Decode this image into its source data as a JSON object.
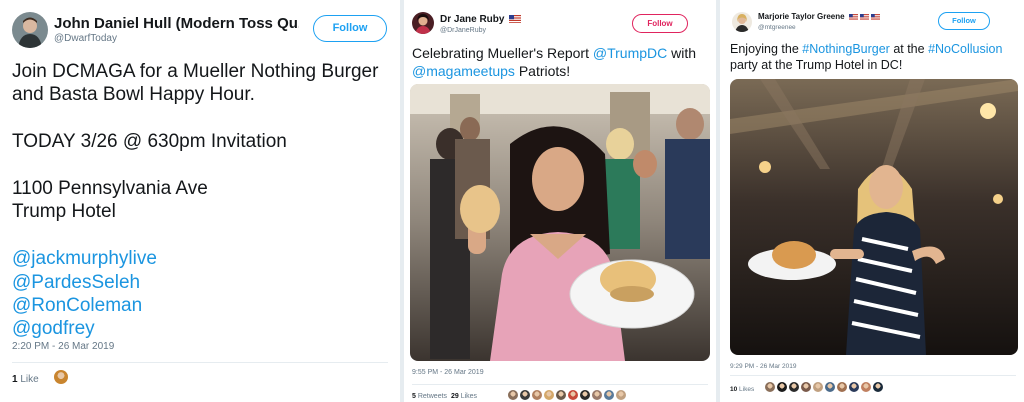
{
  "tweet1": {
    "name": "John Daniel Hull (Modern Toss Qu...",
    "handle": "@DwarfToday",
    "follow_label": "Follow",
    "lines": [
      {
        "text": "Join DCMAGA for a Mueller Nothing Burger",
        "link": false
      },
      {
        "text": "and Basta Bowl Happy Hour.",
        "link": false
      },
      {
        "text": "",
        "link": false
      },
      {
        "text": "TODAY 3/26 @ 630pm Invitation",
        "link": false
      },
      {
        "text": "",
        "link": false
      },
      {
        "text": "1100 Pennsylvania Ave",
        "link": false
      },
      {
        "text": "Trump Hotel",
        "link": false
      },
      {
        "text": "",
        "link": false
      },
      {
        "text": "@jackmurphylive",
        "link": true
      },
      {
        "text": "@PardesSeleh",
        "link": true
      },
      {
        "text": "@RonColeman",
        "link": true
      },
      {
        "text": "@godfrey",
        "link": true
      }
    ],
    "timestamp": "2:20 PM - 26 Mar 2019",
    "likes_count": "1",
    "likes_label": "Like",
    "liker_colors": [
      "#c9852f"
    ]
  },
  "tweet2": {
    "name": "Dr Jane Ruby",
    "flag": "us-flag-icon",
    "handle": "@DrJaneRuby",
    "follow_label": "Follow",
    "follow_color": "#e0245e",
    "segments": [
      {
        "text": "Celebrating Mueller's Report ",
        "link": false
      },
      {
        "text": "@TrumpDC",
        "link": true
      },
      {
        "text": " with ",
        "link": false
      },
      {
        "text": "@magameetups",
        "link": true
      },
      {
        "text": " Patriots!",
        "link": false
      }
    ],
    "timestamp": "9:55 PM - 26 Mar 2019",
    "retweets_count": "5",
    "retweets_label": "Retweets",
    "likes_count": "29",
    "likes_label": "Likes",
    "liker_colors": [
      "#8a6f5a",
      "#3b3b3b",
      "#b08060",
      "#d4a86a",
      "#6a5a4a",
      "#c74a3a",
      "#2a2a2a",
      "#9a7a6a",
      "#5a7a9a",
      "#c0a080"
    ]
  },
  "tweet3": {
    "name": "Marjorie Taylor Greene",
    "flags": [
      "us-flag-icon",
      "us-flag-icon",
      "us-flag-icon"
    ],
    "handle": "@mtgreenee",
    "follow_label": "Follow",
    "segments": [
      {
        "text": "Enjoying the ",
        "link": false
      },
      {
        "text": "#NothingBurger",
        "link": true
      },
      {
        "text": " at the ",
        "link": false
      },
      {
        "text": "#NoCollusion",
        "link": true
      },
      {
        "text": " party at the Trump Hotel in DC!",
        "link": false
      }
    ],
    "timestamp": "9:29 PM - 26 Mar 2019",
    "likes_count": "10",
    "likes_label": "Likes",
    "liker_colors": [
      "#8a6f5a",
      "#1a1a1a",
      "#2a2a2a",
      "#7a5a4a",
      "#c0a080",
      "#4a6a8a",
      "#a07050",
      "#2a3a5a",
      "#c08060",
      "#1a2a3a"
    ]
  }
}
